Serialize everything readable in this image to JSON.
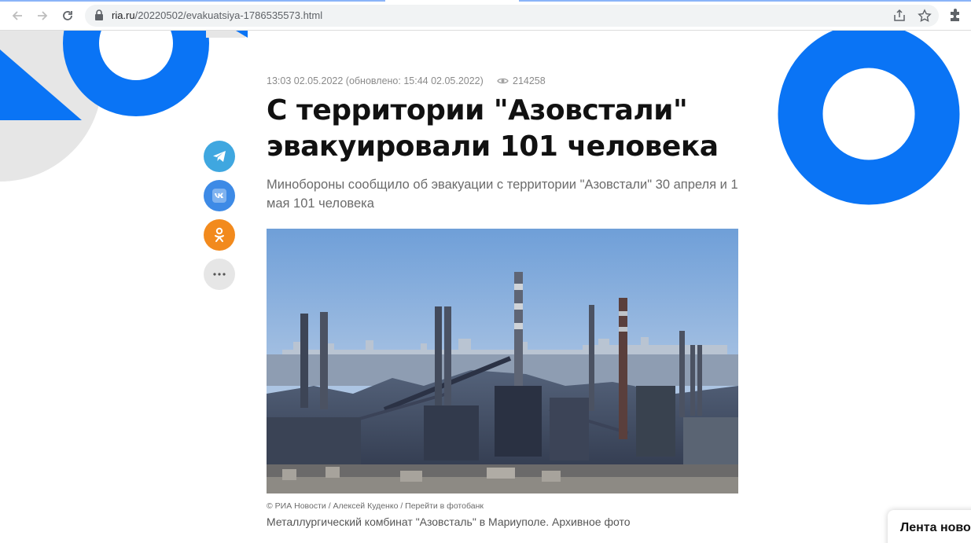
{
  "browser": {
    "url_host": "ria.ru",
    "url_path": "/20220502/evakuatsiya-1786535573.html"
  },
  "article": {
    "meta": "13:03 02.05.2022 (обновлено: 15:44 02.05.2022)",
    "views": "214258",
    "title": "С территории \"Азовстали\" эвакуировали 101 человека",
    "lead": "Минобороны сообщило об эвакуации с территории \"Азовстали\" 30 апреля и 1 мая 101 человека",
    "photo_credit": "© РИА Новости / Алексей Куденко / Перейти в фотобанк",
    "photo_caption": "Металлургический комбинат \"Азовсталь\" в Мариуполе. Архивное фото"
  },
  "share": [
    {
      "icon": "telegram-icon",
      "color": "#3fa7e0"
    },
    {
      "icon": "vk-icon",
      "color": "#3d8ae6"
    },
    {
      "icon": "odnoklassniki-icon",
      "color": "#f28a1d"
    },
    {
      "icon": "more-icon",
      "color": "#e6e6e6"
    }
  ],
  "feed_tab": {
    "label": "Лента ново"
  },
  "colors": {
    "brand_blue": "#0a74f5",
    "light_gray": "#e6e6e6"
  }
}
